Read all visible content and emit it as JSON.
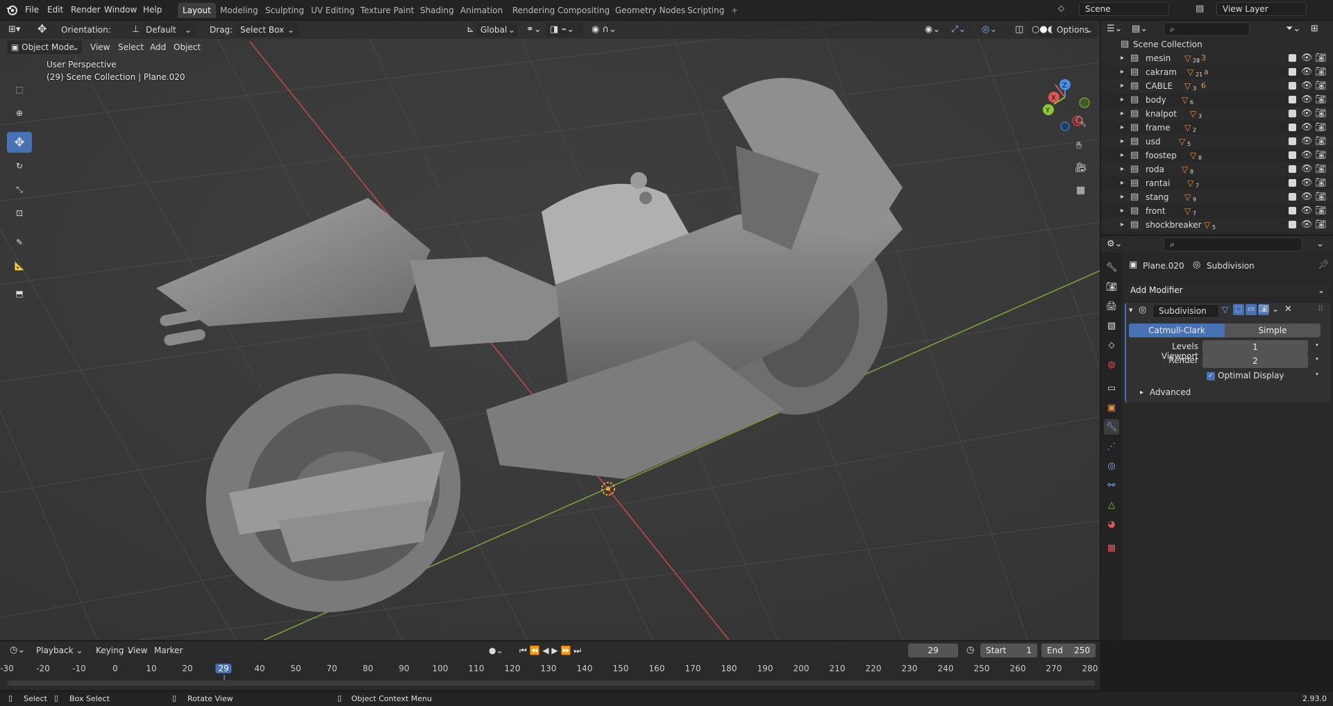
{
  "menu": {
    "file": "File",
    "edit": "Edit",
    "render": "Render",
    "window": "Window",
    "help": "Help"
  },
  "workspaces": [
    "Layout",
    "Modeling",
    "Sculpting",
    "UV Editing",
    "Texture Paint",
    "Shading",
    "Animation",
    "Rendering",
    "Compositing",
    "Geometry Nodes",
    "Scripting"
  ],
  "scene": {
    "name": "Scene",
    "view_layer": "View Layer"
  },
  "viewport_header": {
    "orientation_label": "Orientation:",
    "orientation_value": "Default",
    "drag_label": "Drag:",
    "drag_value": "Select Box",
    "transform_orientation": "Global",
    "options": "Options"
  },
  "viewport_header2": {
    "mode": "Object Mode",
    "view": "View",
    "select": "Select",
    "add": "Add",
    "object": "Object"
  },
  "viewport_info": {
    "perspective": "User Perspective",
    "collection": "(29) Scene Collection | Plane.020"
  },
  "gizmo": {
    "x": "X",
    "y": "Y",
    "z": "Z"
  },
  "outliner": {
    "root": "Scene Collection",
    "items": [
      {
        "name": "mesin",
        "count": "28",
        "count2": "3"
      },
      {
        "name": "cakram",
        "count": "21",
        "count2": "a"
      },
      {
        "name": "CABLE",
        "count": "3",
        "count2": "6"
      },
      {
        "name": "body",
        "count": "6",
        "count2": ""
      },
      {
        "name": "knalpot",
        "count": "3",
        "count2": ""
      },
      {
        "name": "frame",
        "count": "2",
        "count2": ""
      },
      {
        "name": "usd",
        "count": "5",
        "count2": ""
      },
      {
        "name": "foostep",
        "count": "8",
        "count2": ""
      },
      {
        "name": "roda",
        "count": "8",
        "count2": ""
      },
      {
        "name": "rantai",
        "count": "7",
        "count2": ""
      },
      {
        "name": "stang",
        "count": "9",
        "count2": ""
      },
      {
        "name": "front",
        "count": "7",
        "count2": ""
      },
      {
        "name": "shockbreaker",
        "count": "5",
        "count2": ""
      }
    ]
  },
  "properties": {
    "object_name": "Plane.020",
    "modifier_context": "Subdivision",
    "add_modifier": "Add Modifier",
    "modifier_name": "Subdivision",
    "method_a": "Catmull-Clark",
    "method_b": "Simple",
    "levels_viewport_label": "Levels Viewport",
    "levels_viewport_value": "1",
    "render_label": "Render",
    "render_value": "2",
    "optimal_display": "Optimal Display",
    "advanced": "Advanced"
  },
  "timeline": {
    "playback": "Playback",
    "keying": "Keying",
    "view": "View",
    "marker": "Marker",
    "current_frame": "29",
    "start_label": "Start",
    "start_value": "1",
    "end_label": "End",
    "end_value": "250",
    "ticks": [
      "-30",
      "-20",
      "-10",
      "0",
      "10",
      "20",
      "29",
      "40",
      "50",
      "70",
      "80",
      "90",
      "100",
      "110",
      "120",
      "130",
      "140",
      "150",
      "160",
      "170",
      "180",
      "190",
      "200",
      "210",
      "220",
      "230",
      "240",
      "250",
      "260",
      "270",
      "280"
    ]
  },
  "statusbar": {
    "select": "Select",
    "box_select": "Box Select",
    "rotate_view": "Rotate View",
    "context_menu": "Object Context Menu",
    "version": "2.93.0"
  },
  "colors": {
    "accent": "#4772b3",
    "axis_x": "#c84a4a",
    "axis_y": "#7ea83a",
    "gizmo_x": "#e05555",
    "gizmo_y": "#8cc43a",
    "gizmo_z": "#4b8fe0",
    "object_orange": "#e8954a"
  }
}
